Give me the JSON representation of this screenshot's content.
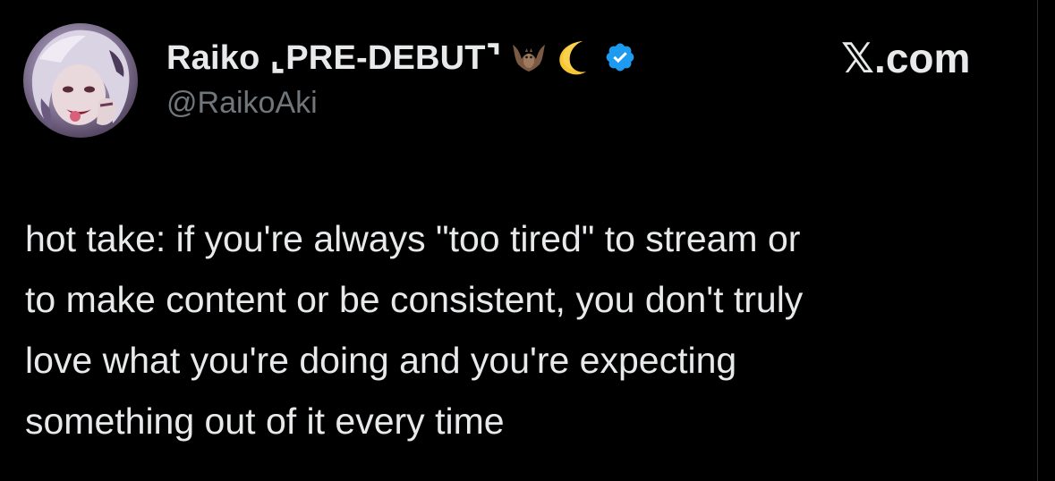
{
  "tweet": {
    "author": {
      "display_name": "Raiko ⌞PRE-DEBUT⌝",
      "emojis": [
        "bat-emoji",
        "crescent-moon-emoji"
      ],
      "verified": true,
      "handle": "@RaikoAki"
    },
    "brand": {
      "label": "𝕏.com"
    },
    "text": "hot take: if you're always \"too tired\" to stream or\nto make content or be consistent, you don't truly\nlove what you're doing and you're expecting\nsomething out of it every time"
  },
  "colors": {
    "background": "#000000",
    "primary_text": "#e7e9ea",
    "secondary_text": "#71767b",
    "verified_badge": "#1d9bf0"
  }
}
